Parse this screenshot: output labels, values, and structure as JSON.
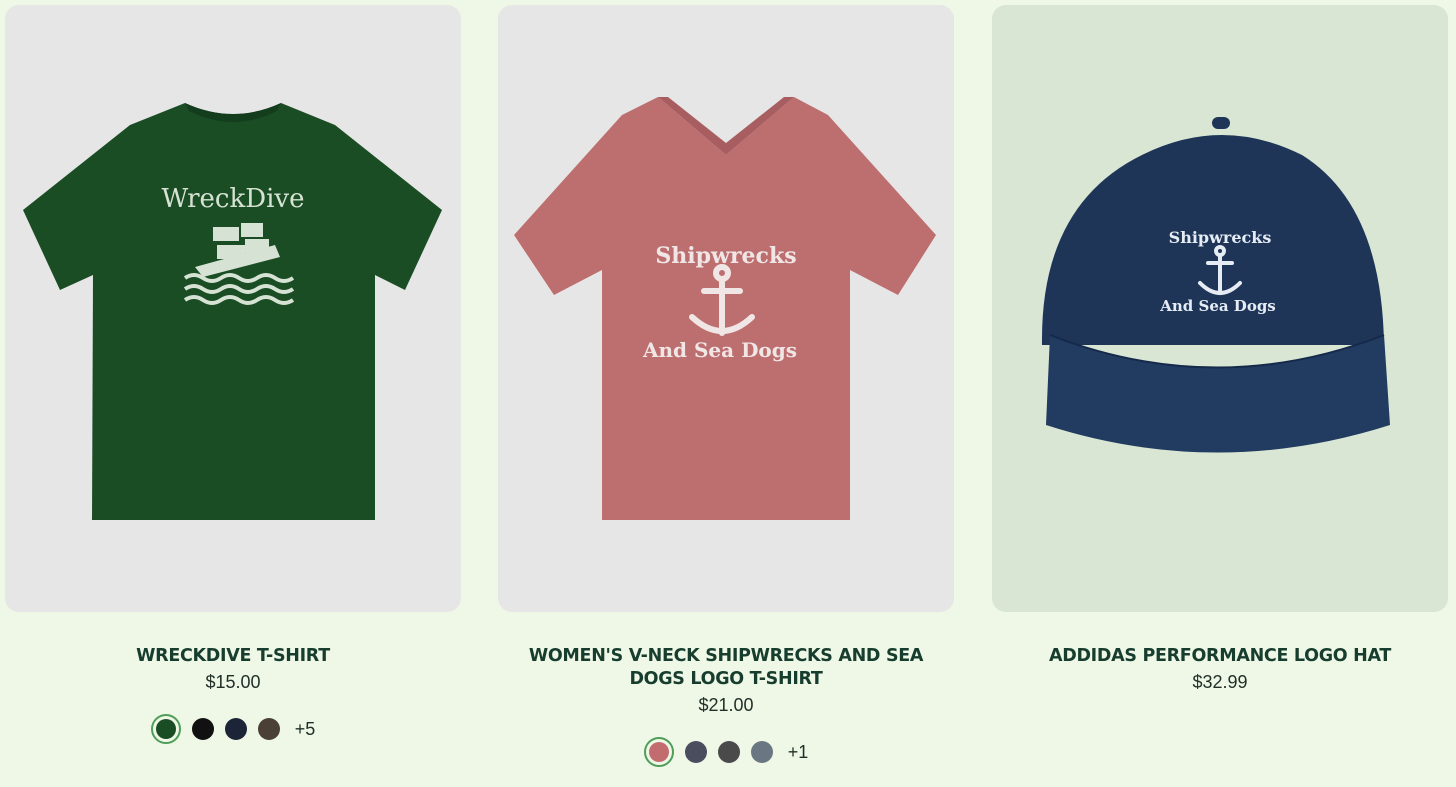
{
  "products": [
    {
      "name": "WRECKDIVE T-SHIRT",
      "price": "$15.00",
      "print_text": "WreckDive",
      "shirt_color": "#1b4d25",
      "swatches": [
        "#1b4d25",
        "#111111",
        "#1c2438",
        "#4a4036"
      ],
      "selected_swatch": 0,
      "more": "+5"
    },
    {
      "name": "WOMEN'S V-NECK SHIPWRECKS AND SEA DOGS LOGO T-SHIRT",
      "price": "$21.00",
      "print_text_top": "Shipwrecks",
      "print_text_bottom": "And Sea Dogs",
      "shirt_color": "#bd6f70",
      "swatches": [
        "#c26c6f",
        "#4a4d5e",
        "#4a4a4a",
        "#6a7782"
      ],
      "selected_swatch": 0,
      "more": "+1"
    },
    {
      "name": "ADDIDAS PERFORMANCE LOGO HAT",
      "price": "$32.99",
      "print_text_top": "Shipwrecks",
      "print_text_bottom": "And Sea Dogs",
      "hat_color": "#1e3558"
    }
  ]
}
